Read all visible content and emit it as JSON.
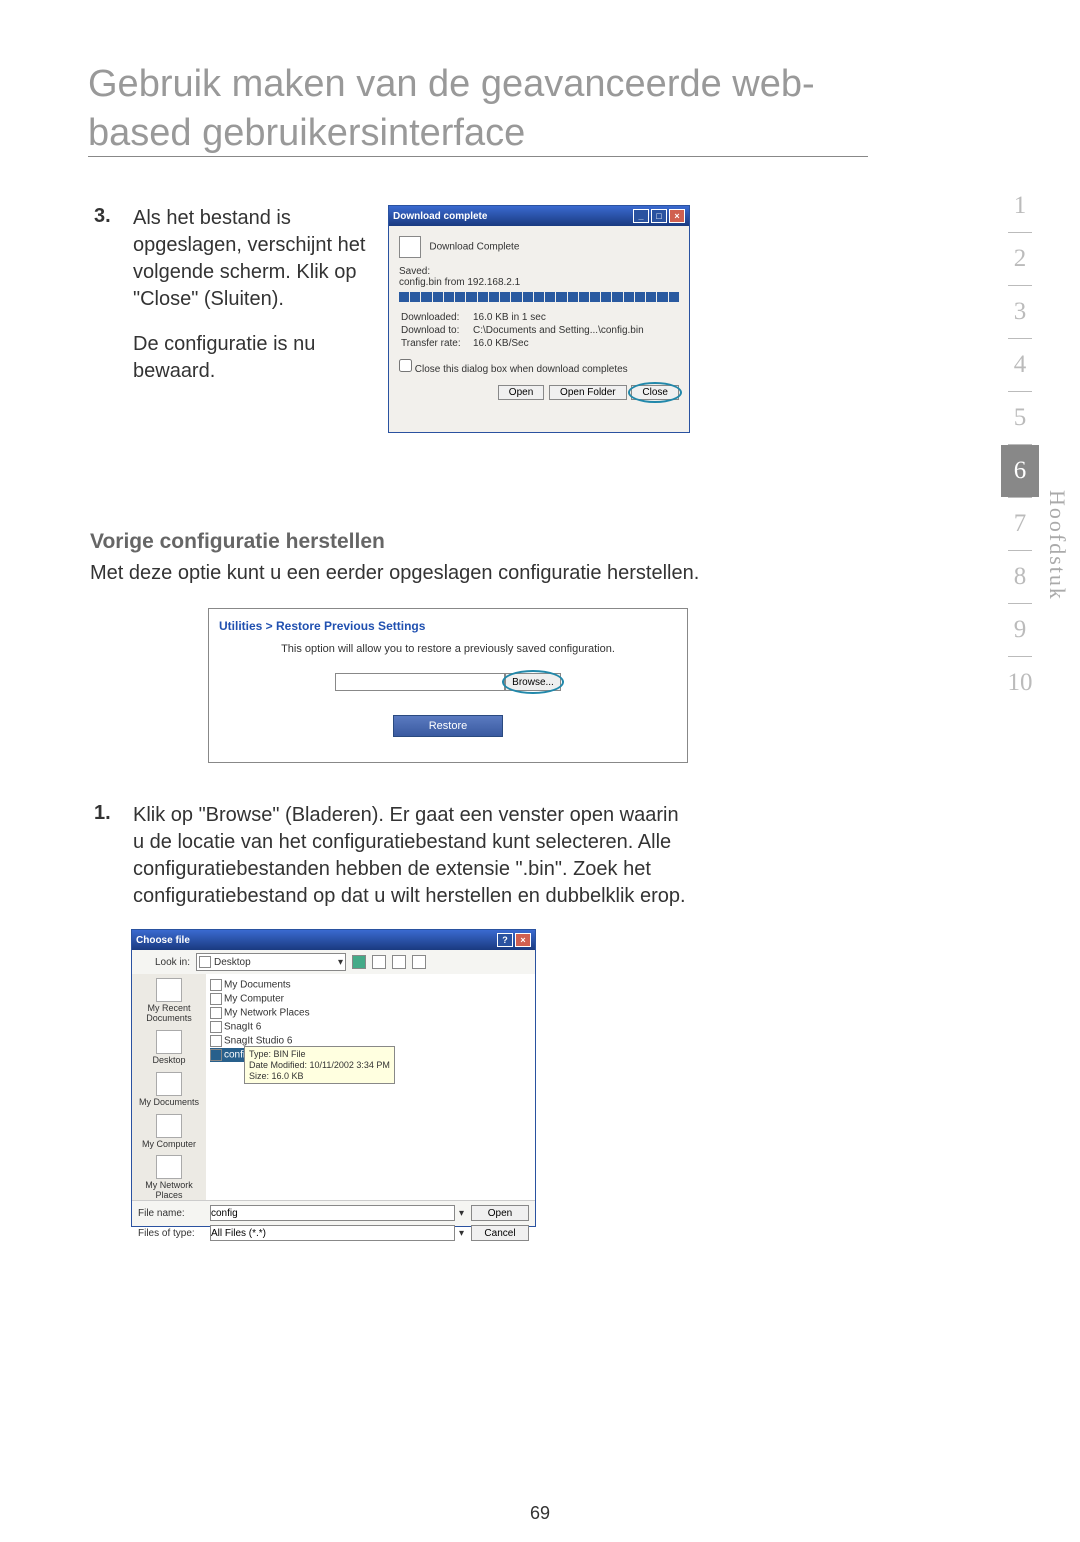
{
  "title": "Gebruik maken van de geavanceerde web-based gebruikersinterface",
  "step3": {
    "num": "3.",
    "text_a": "Als het bestand is opgeslagen, verschijnt het volgende scherm. Klik op \"Close\" (Sluiten).",
    "text_b": "De configuratie is nu bewaard."
  },
  "download_dialog": {
    "title": "Download complete",
    "header": "Download Complete",
    "saved_label": "Saved:",
    "saved_file": "config.bin from 192.168.2.1",
    "downloaded_label": "Downloaded:",
    "downloaded_value": "16.0 KB in 1 sec",
    "download_to_label": "Download to:",
    "download_to_value": "C:\\Documents and Setting...\\config.bin",
    "transfer_label": "Transfer rate:",
    "transfer_value": "16.0 KB/Sec",
    "checkbox": "Close this dialog box when download completes",
    "open": "Open",
    "open_folder": "Open Folder",
    "close": "Close"
  },
  "subheading": "Vorige configuratie herstellen",
  "sub_text": "Met deze optie kunt u een eerder opgeslagen configuratie herstellen.",
  "restore_panel": {
    "title": "Utilities > Restore Previous Settings",
    "desc": "This option will allow you to restore a previously saved configuration.",
    "browse": "Browse...",
    "restore": "Restore"
  },
  "step1": {
    "num": "1.",
    "text": "Klik op \"Browse\" (Bladeren). Er gaat een venster open waarin u de locatie van het configuratiebestand kunt selecteren. Alle configuratiebestanden hebben de extensie \".bin\". Zoek het configuratiebestand op dat u wilt herstellen en dubbelklik erop."
  },
  "choose_file": {
    "title": "Choose file",
    "lookin_label": "Look in:",
    "lookin_value": "Desktop",
    "sidebar": [
      "My Recent Documents",
      "Desktop",
      "My Documents",
      "My Computer",
      "My Network Places"
    ],
    "files": [
      "My Documents",
      "My Computer",
      "My Network Places",
      "SnagIt 6",
      "SnagIt Studio 6",
      "config"
    ],
    "tooltip": {
      "type": "Type: BIN File",
      "date": "Date Modified: 10/11/2002 3:34 PM",
      "size": "Size: 16.0 KB"
    },
    "filename_label": "File name:",
    "filename_value": "config",
    "filetype_label": "Files of type:",
    "filetype_value": "All Files (*.*)",
    "open": "Open",
    "cancel": "Cancel"
  },
  "chapters": [
    "1",
    "2",
    "3",
    "4",
    "5",
    "6",
    "7",
    "8",
    "9",
    "10"
  ],
  "chapter_label": "Hoofdstuk",
  "page_num": "69"
}
